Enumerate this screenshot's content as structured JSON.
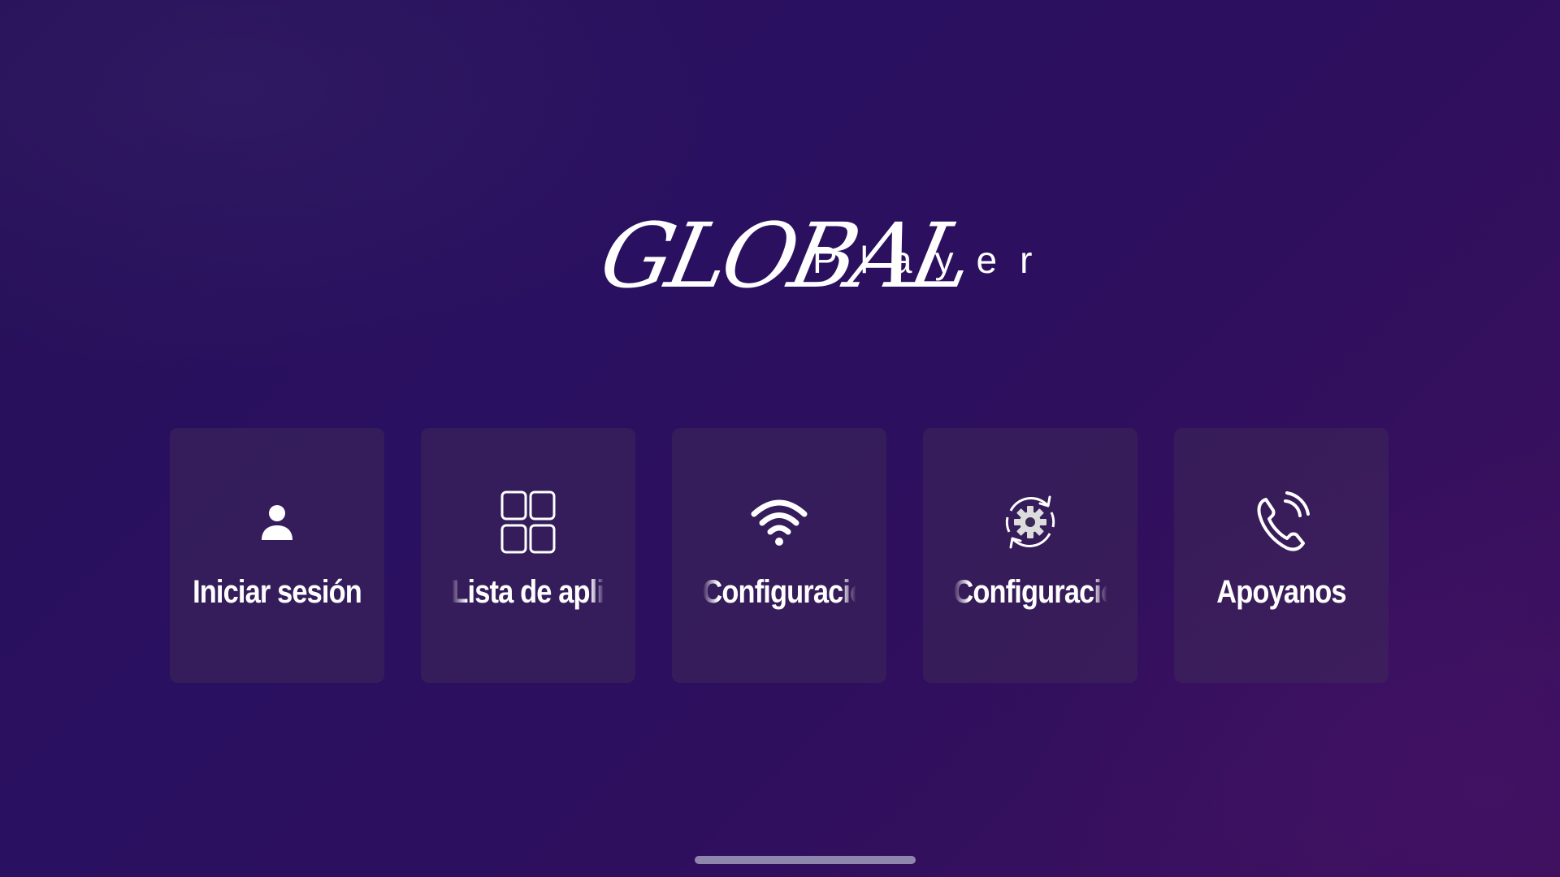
{
  "app": {
    "logo_script": "GLOBAL",
    "logo_suffix": "Player"
  },
  "menu": {
    "items": [
      {
        "label": "Iniciar sesión",
        "icon": "user-icon"
      },
      {
        "label": "Lista de aplicaciones",
        "icon": "apps-grid-icon"
      },
      {
        "label": "Configuración de red",
        "icon": "wifi-icon"
      },
      {
        "label": "Configuración del sistema",
        "icon": "settings-sync-icon"
      },
      {
        "label": "Apoyanos",
        "icon": "phone-call-icon"
      }
    ]
  },
  "colors": {
    "background": "#2a1060",
    "tile": "#3e2858",
    "text": "#ffffff",
    "home_indicator": "#8f86ad"
  }
}
